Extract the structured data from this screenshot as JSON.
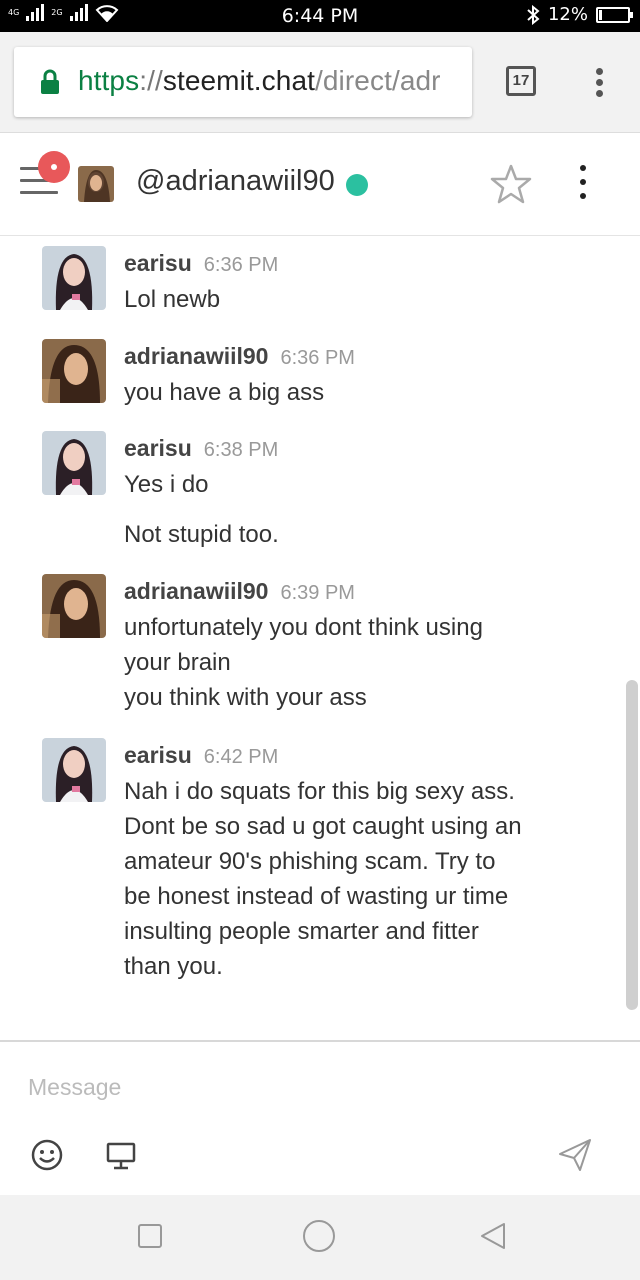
{
  "status_bar": {
    "network_label_1": "4G",
    "network_label_2": "2G",
    "time": "6:44 PM",
    "battery_percent": "12%",
    "battery_level": 0.12
  },
  "browser": {
    "url_scheme": "https",
    "url_separator": "://",
    "url_host": "steemit.chat",
    "url_path": "/direct/adr",
    "tab_count": "17"
  },
  "chat_header": {
    "username": "@adrianawiil90",
    "online_color": "#2bc0a0"
  },
  "messages": [
    {
      "user": "earisu",
      "time": "6:36 PM",
      "lines": [
        "Lol newb"
      ]
    },
    {
      "user": "adrianawiil90",
      "time": "6:36 PM",
      "lines": [
        "you have a big ass"
      ]
    },
    {
      "user": "earisu",
      "time": "6:38 PM",
      "lines": [
        "Yes i do",
        "Not stupid too."
      ]
    },
    {
      "user": "adrianawiil90",
      "time": "6:39 PM",
      "lines": [
        "unfortunately you dont think using",
        "your brain",
        "you think with your ass"
      ]
    },
    {
      "user": "earisu",
      "time": "6:42 PM",
      "lines": [
        "Nah i do squats for this big sexy ass.",
        "Dont be so sad u got caught using an",
        "amateur 90's phishing scam. Try to",
        "be honest instead of wasting ur time",
        "insulting people smarter and fitter",
        "than you."
      ]
    }
  ],
  "composer": {
    "placeholder": "Message",
    "value": ""
  },
  "icons": {
    "lock": "lock-icon",
    "menu": "hamburger-menu-icon",
    "star": "star-icon",
    "emoji": "emoji-icon",
    "screen": "screen-share-icon",
    "send": "send-icon"
  }
}
